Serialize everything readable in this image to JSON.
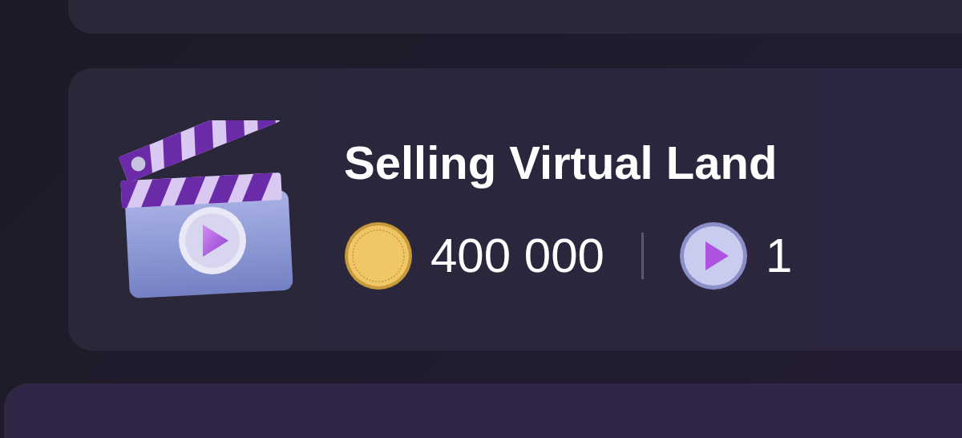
{
  "task": {
    "title": "Selling Virtual Land",
    "rewards": [
      {
        "kind": "coin",
        "amount": "400 000"
      },
      {
        "kind": "video",
        "amount": "1"
      }
    ]
  }
}
